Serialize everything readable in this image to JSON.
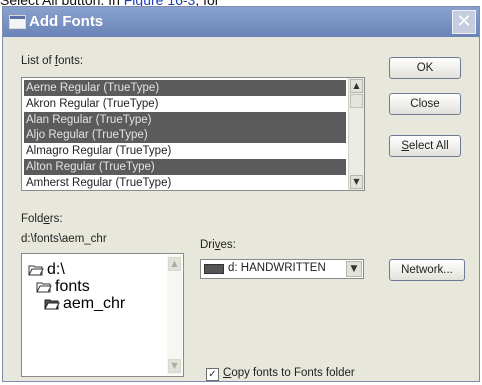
{
  "background": {
    "text_before": "Select All button. In ",
    "link_text": "Figure 16-3",
    "text_after": ", for"
  },
  "dialog": {
    "title": "Add Fonts",
    "close_glyph": "✕",
    "fonts_list": {
      "label_pre": "List of ",
      "label_key": "f",
      "label_post": "onts:",
      "items": [
        {
          "label": "Aerne Regular (TrueType)",
          "selected": true
        },
        {
          "label": "Akron Regular (TrueType)",
          "selected": false
        },
        {
          "label": "Alan Regular (TrueType)",
          "selected": true
        },
        {
          "label": "Aljo Regular (TrueType)",
          "selected": true
        },
        {
          "label": "Almagro Regular (TrueType)",
          "selected": false
        },
        {
          "label": "Alton Regular (TrueType)",
          "selected": true
        },
        {
          "label": "Amherst Regular (TrueType)",
          "selected": false
        }
      ]
    },
    "buttons": {
      "ok": "OK",
      "close": "Close",
      "select_all_key": "S",
      "select_all_rest": "elect All",
      "network": "Network..."
    },
    "folders": {
      "label_pre": "Fold",
      "label_key": "e",
      "label_post": "rs:",
      "current_path": "d:\\fonts\\aem_chr",
      "tree": [
        {
          "label": "d:\\",
          "icon": "open-folder-icon",
          "open": true
        },
        {
          "label": "fonts",
          "icon": "open-folder-icon",
          "open": true
        },
        {
          "label": "aem_chr",
          "icon": "open-folder-icon",
          "open": true
        }
      ]
    },
    "drives": {
      "label_pre": "Dri",
      "label_key": "v",
      "label_post": "es:",
      "selected": "d: HANDWRITTEN"
    },
    "copy_option": {
      "checked": true,
      "check_glyph": "✓",
      "label_key": "C",
      "label_rest": "opy fonts to Fonts folder"
    }
  }
}
